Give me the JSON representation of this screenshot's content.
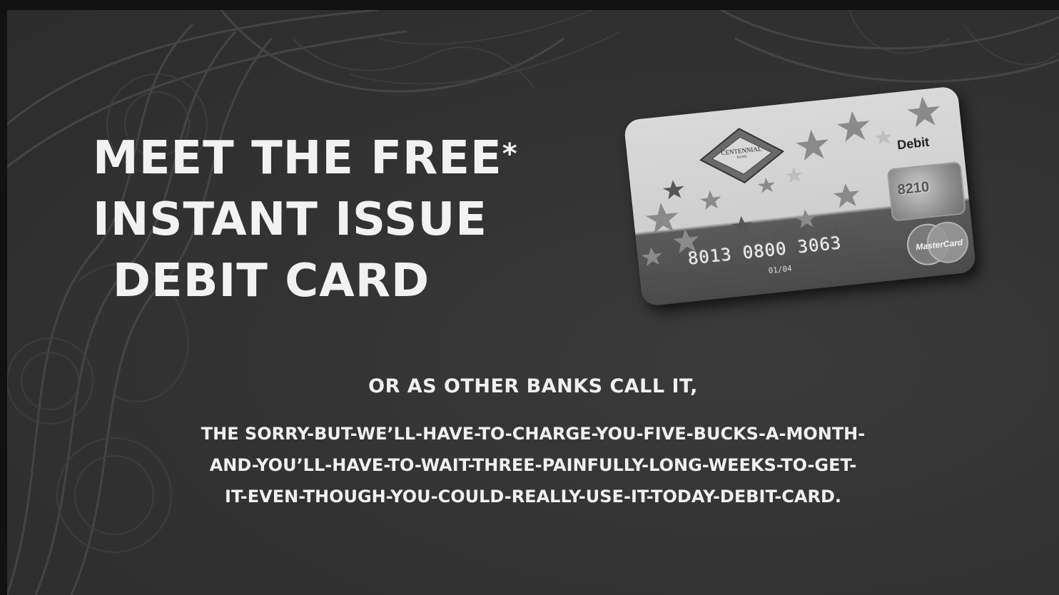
{
  "headline": {
    "line1": "MEET THE FREE",
    "asterisk": "*",
    "line2": "INSTANT ISSUE",
    "line3": "DEBIT CARD"
  },
  "card": {
    "bank_name": "CENTENNIAL",
    "bank_sub": "BANK",
    "debit_label": "Debit",
    "hologram_text": "8210",
    "number": "8013 0800 3063",
    "small_text": "01/04",
    "network": "MasterCard"
  },
  "subtitle": "OR AS OTHER BANKS CALL IT,",
  "body": {
    "line1": "THE SORRY-BUT-WE’LL-HAVE-TO-CHARGE-YOU-FIVE-BUCKS-A-MONTH-",
    "line2": "AND-YOU’LL-HAVE-TO-WAIT-THREE-PAINFULLY-LONG-WEEKS-TO-GET-",
    "line3": "IT-EVEN-THOUGH-YOU-COULD-REALLY-USE-IT-TODAY-DEBIT-CARD."
  },
  "colors": {
    "background": "#333333",
    "text": "#f2f2f2"
  }
}
